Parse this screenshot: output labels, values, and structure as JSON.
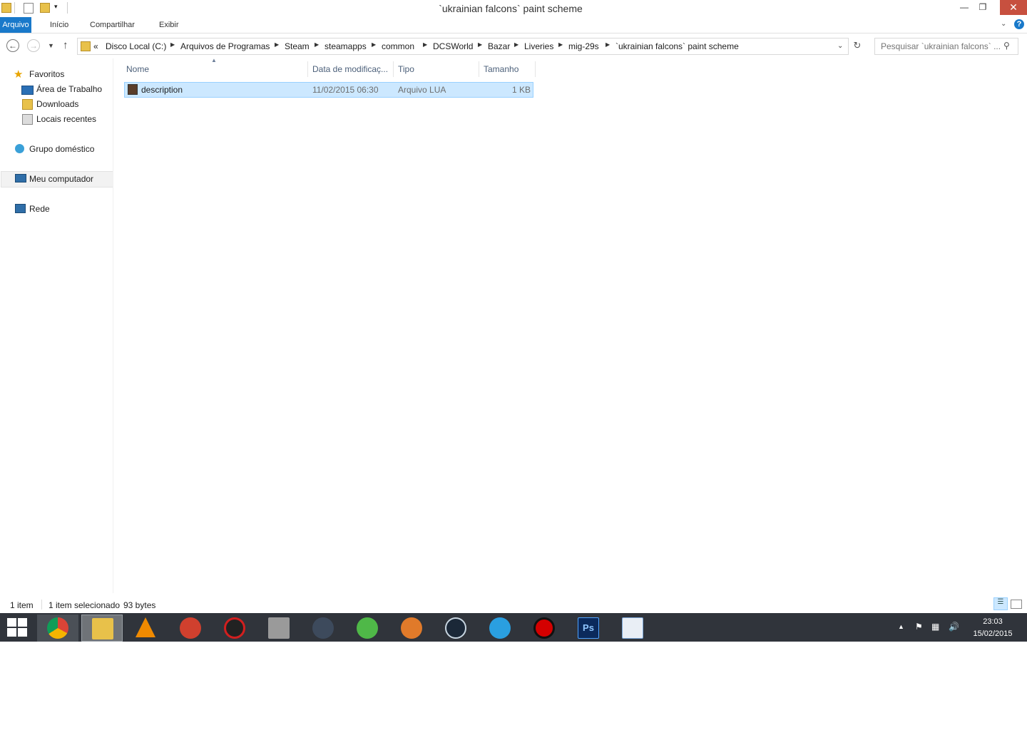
{
  "window": {
    "title": "`ukrainian falcons` paint scheme"
  },
  "ribbon": {
    "tabs": [
      "Arquivo",
      "Início",
      "Compartilhar",
      "Exibir"
    ]
  },
  "breadcrumb": {
    "overflow": "«",
    "items": [
      "Disco Local (C:)",
      "Arquivos de Programas",
      "Steam",
      "steamapps",
      "common",
      "DCSWorld",
      "Bazar",
      "Liveries",
      "mig-29s",
      "`ukrainian falcons` paint scheme"
    ]
  },
  "search": {
    "placeholder": "Pesquisar `ukrainian falcons` ..."
  },
  "nav": {
    "favorites": "Favoritos",
    "fav_items": [
      "Área de Trabalho",
      "Downloads",
      "Locais recentes"
    ],
    "homegroup": "Grupo doméstico",
    "computer": "Meu computador",
    "network": "Rede"
  },
  "columns": {
    "name": "Nome",
    "date": "Data de modificaç...",
    "type": "Tipo",
    "size": "Tamanho"
  },
  "files": [
    {
      "name": "description",
      "date": "11/02/2015 06:30",
      "type": "Arquivo LUA",
      "size": "1 KB"
    }
  ],
  "status": {
    "count": "1 item",
    "selected": "1 item selecionado",
    "bytes": "93 bytes"
  },
  "clock": {
    "time": "23:03",
    "date": "15/02/2015"
  },
  "taskbar": {
    "apps": [
      "start-icon",
      "chrome-icon",
      "file-explorer-icon",
      "vlc-icon",
      "ccleaner-icon",
      "blocked-app-icon",
      "wall-app-icon",
      "dark-sphere-app-icon",
      "utorrent-icon",
      "mascot-app-icon",
      "steam-icon",
      "internet-explorer-icon",
      "record-app-icon",
      "photoshop-icon",
      "wordpad-icon"
    ]
  },
  "colors": {
    "accent": "#1979ca",
    "selection": "#cce8ff",
    "taskbar": "#30343b",
    "close": "#c7503f"
  }
}
